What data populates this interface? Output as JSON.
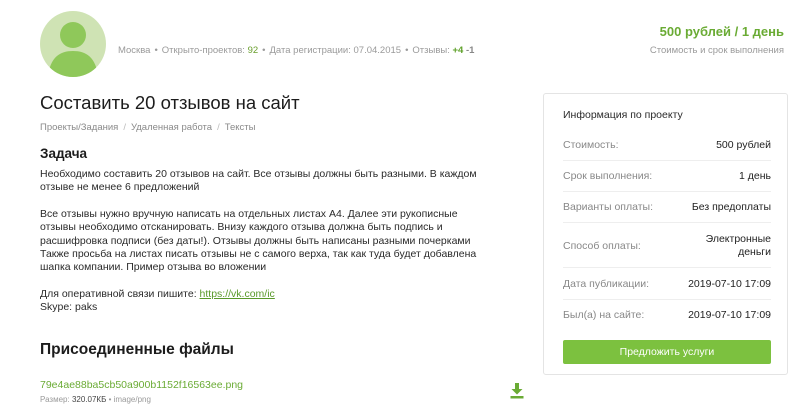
{
  "user": {
    "city": "Москва",
    "open_projects_label": "Открыто-проектов:",
    "open_projects_value": "92",
    "registered_label": "Дата регистрации:",
    "registered_value": "07.04.2015",
    "reviews_label": "Отзывы:",
    "reviews_positive": "+4",
    "reviews_negative": "-1"
  },
  "price": {
    "value": "500 рублей / 1 день",
    "caption": "Стоимость и срок выполнения"
  },
  "project": {
    "title": "Составить 20 отзывов на сайт",
    "breadcrumbs": [
      "Проекты/Задания",
      "Удаленная работа",
      "Тексты"
    ],
    "task_heading": "Задача",
    "paragraphs": [
      "Необходимо составить 20 отзывов на сайт. Все отзывы должны быть разными. В каждом\nотзыве не менее 6 предложений",
      "Все отзывы нужно вручную написать на отдельных листах А4. Далее эти рукописные\nотзывы необходимо отсканировать. Внизу каждого отзыва должна быть подпись и\nрасшифровка подписи (без даты!). Отзывы должны быть написаны разными почерками\nТакже просьба на листах писать отзывы не с самого верха, так как туда будет добавлена\nшапка компании. Пример отзыва во вложении"
    ],
    "contact_text": "Для оперативной связи пишите: ",
    "contact_link": "https://vk.com/ic",
    "skype": "Skype: paks"
  },
  "files": {
    "heading": "Присоединенные файлы",
    "items": [
      {
        "name": "79e4ae88ba5cb50a900b1152f16563ee.png",
        "size_label": "Размер:",
        "size_value": "320.07КБ",
        "type": "image/png",
        "icon": "download-icon"
      }
    ]
  },
  "info_panel": {
    "title": "Информация по проекту",
    "rows": [
      {
        "label": "Стоимость:",
        "value": "500 рублей"
      },
      {
        "label": "Срок выполнения:",
        "value": "1 день"
      },
      {
        "label": "Варианты оплаты:",
        "value": "Без предоплаты"
      },
      {
        "label": "Способ оплаты:",
        "value": "Электронные\nденьги"
      },
      {
        "label": "Дата публикации:",
        "value": "2019-07-10 17:09"
      },
      {
        "label": "Был(а) на сайте:",
        "value": "2019-07-10 17:09"
      }
    ],
    "button_label": "Предложить услуги"
  },
  "colors": {
    "accent": "#7cc13f",
    "link": "#6aab34",
    "avatar_bg": "#cfe3b4",
    "avatar_fg": "#8fc85a"
  },
  "icons": [
    "avatar-silhouette-icon",
    "download-icon"
  ]
}
